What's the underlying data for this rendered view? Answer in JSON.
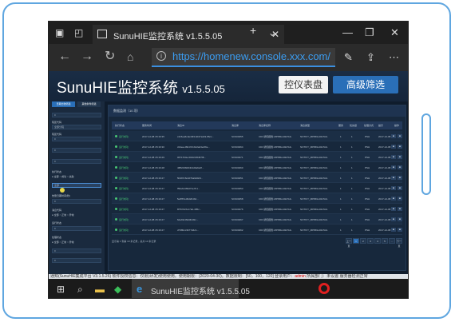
{
  "browser": {
    "tab_title": "SunuHIE监控系统 v1.5.5.05",
    "url": "https://homenew.console.xxx.com/"
  },
  "app": {
    "title": "SunuHIE监控系统",
    "version": "v1.5.5.05",
    "btn_dashboard": "控仪表盘",
    "btn_advanced": "高级筛选"
  },
  "sidebar": {
    "tabs": [
      "日期比较筛选",
      "其他条件筛选"
    ],
    "fields": [
      {
        "label": "",
        "value": "0"
      },
      {
        "label": "院区代码",
        "value": ""
      },
      {
        "label": "",
        "value": "全部分院"
      },
      {
        "label": "院区代码",
        "value": ""
      },
      {
        "label": "",
        "value": "0"
      },
      {
        "label": "",
        "value": "0"
      },
      {
        "label": "",
        "value": "0"
      }
    ],
    "labels_lower": [
      "执行状态",
      "告警日期时间(秒)",
      "消息代码",
      "运行状态",
      "处理状态"
    ],
    "radio_text": [
      "● 全部  ○ 成功  ○ 失败",
      "● 全部  ○ 正常  ○ 异常",
      "● 全部  ○ 正常  ○ 异常"
    ],
    "highlight_value": "全部"
  },
  "main": {
    "header": "数据监测（10 项）",
    "columns": [
      "执行状态",
      "服务时间",
      "消息ID",
      "消息库",
      "消息库名称",
      "消息类型",
      "服务",
      "优先级",
      "处理方式",
      "提示",
      "操作"
    ],
    "rows": [
      {
        "status": "运行成功",
        "time": "2017-12-08 15:16:35",
        "msgid": "c4c5ea6cde40f4-9d47a4c9-86cc...",
        "db": "SCS00455",
        "dbname": "CDC通知服务-MPIBILLDETAIL",
        "type": "NOTIFY_MPIBILLDETAIL",
        "svc": "1",
        "pri": "1",
        "proc": "PSH",
        "tip": "2017-12-08"
      },
      {
        "status": "运行成功",
        "time": "2017-12-08 15:16:30",
        "msgid": "c0dea-d6b47d1b42a23e4f9e...",
        "db": "SCS00464",
        "dbname": "CDC通知服务-MPIBILLDETAIL",
        "type": "NOTIFY_MPIBILLDETAIL",
        "svc": "1",
        "pri": "1",
        "proc": "PSH",
        "tip": "2017-12-08"
      },
      {
        "status": "运行成功",
        "time": "2017-12-08 15:16:29",
        "msgid": "06717b0e-601f2c5b6f7f8...",
        "db": "SCS00471",
        "dbname": "CDC通知服务-MPIBILLDETAIL",
        "type": "NOTIFY_MPIBILLDETAIL",
        "svc": "1",
        "pri": "1",
        "proc": "PSH",
        "tip": "2017-12-08"
      },
      {
        "status": "运行成功",
        "time": "2017-12-08 15:16:28",
        "msgid": "4f8f2238d04b4d0a9e0f...",
        "db": "SCS00460",
        "dbname": "CDC通知服务-MPIBILLDETAIL",
        "type": "NOTIFY_MPIBILLDETAIL",
        "svc": "1",
        "pri": "1",
        "proc": "PSH",
        "tip": "2017-12-08"
      },
      {
        "status": "运行成功",
        "time": "2017-12-08 15:16:27",
        "msgid": "5b397c6c2d7ba9d0c9...",
        "db": "SCS00451",
        "dbname": "CDC通知服务-MPIBILLDETAIL",
        "type": "NOTIFY_MPIBILLDETAIL",
        "svc": "1",
        "pri": "1",
        "proc": "PSH",
        "tip": "2017-12-08"
      },
      {
        "status": "运行成功",
        "time": "2017-12-08 15:16:27",
        "msgid": "f56ab1469d71e7b1...",
        "db": "SCS00453",
        "dbname": "CDC通知服务-MPIBILLDETAIL",
        "type": "NOTIFY_MPIBILLDETAIL",
        "svc": "1",
        "pri": "1",
        "proc": "PSH",
        "tip": "2017-12-08"
      },
      {
        "status": "运行成功",
        "time": "2017-12-08 15:16:27",
        "msgid": "5e8f67e30d2b4b2...",
        "db": "SCS00458",
        "dbname": "CDC通知服务-MPIBILLDETAIL",
        "type": "NOTIFY_MPIBILLDETAIL",
        "svc": "1",
        "pri": "1",
        "proc": "PSH",
        "tip": "2017-12-08"
      },
      {
        "status": "运行成功",
        "time": "2017-12-08 15:16:27",
        "msgid": "8f767d2b-b7ab-485c...",
        "db": "SCS00476",
        "dbname": "CDC通知服务-MPIBILLDETAIL",
        "type": "NOTIFY_MPIBILLDETAIL",
        "svc": "1",
        "pri": "1",
        "proc": "PSH",
        "tip": "2017-12-08"
      },
      {
        "status": "运行成功",
        "time": "2017-12-08 15:16:27",
        "msgid": "6deb9c39d3b4f2c...",
        "db": "SCS00467",
        "dbname": "CDC通知服务-MPIBILLDETAIL",
        "type": "NOTIFY_MPIBILLDETAIL",
        "svc": "1",
        "pri": "1",
        "proc": "PSH",
        "tip": "2017-12-08"
      },
      {
        "status": "运行成功",
        "time": "2017-12-08 15:16:27",
        "msgid": "d738bcc3b77d4c1...",
        "db": "SCS00462",
        "dbname": "CDC通知服务-MPIBILLDETAIL",
        "type": "NOTIFY_MPIBILLDETAIL",
        "svc": "1",
        "pri": "1",
        "proc": "PSH",
        "tip": "2017-12-08"
      }
    ],
    "action_label": "■",
    "footer_summary": "显示第 1 到第 10 条记录，总共 10 条记录",
    "pager": [
      "上一页",
      "1",
      "2",
      "3",
      "4",
      "5",
      "…",
      "下一页"
    ]
  },
  "statusbar": {
    "text": "通知(SunuHIE集成平台 V3.1.5.26)   软件授权信息：仅限(研发)使用使用。使用期限：(2020-04-30)。数据限制：[50，100，120]   登录用户：",
    "user": "admin",
    "text2": "所属部门：未设置   服务器检测正常"
  },
  "taskbar": {
    "task_title": "SunuHIE监控系统 v1.5.5.05"
  },
  "colors": {
    "accent": "#2a6fb8",
    "success": "#48c774",
    "frame": "#5fa6e0"
  }
}
